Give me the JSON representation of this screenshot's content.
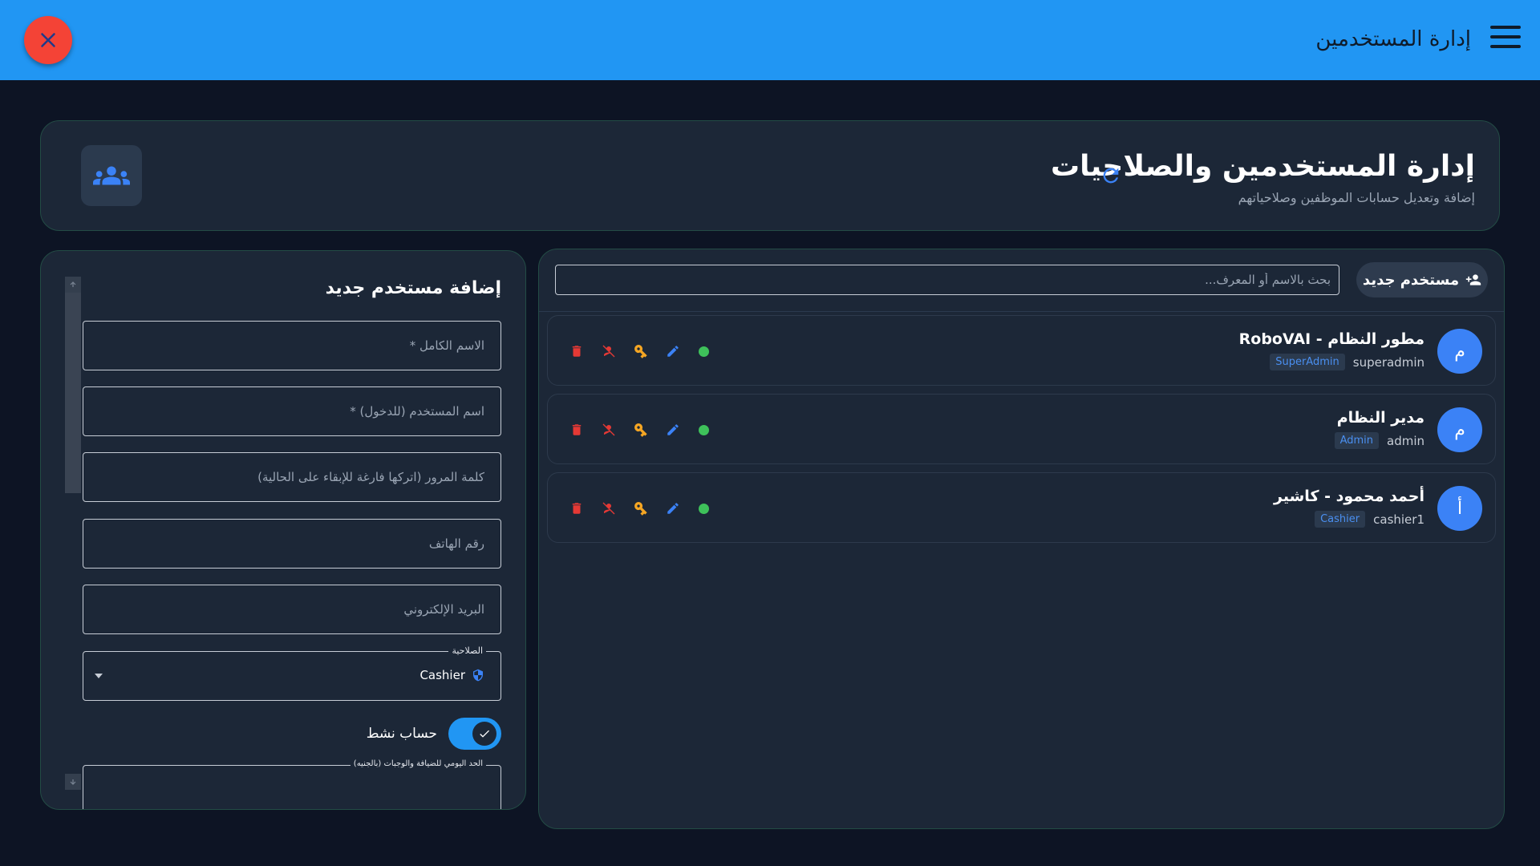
{
  "appbar": {
    "title": "إدارة المستخدمين",
    "menu_icon": "hamburger-menu-icon",
    "close_icon": "close-icon",
    "close_color": "#f44336",
    "bar_color": "#2196f3"
  },
  "header": {
    "title": "إدارة المستخدمين والصلاحيات",
    "subtitle": "إضافة وتعديل حسابات الموظفين وصلاحياتهم",
    "refresh_icon": "refresh-icon",
    "group_icon": "users-group-icon"
  },
  "toolbar": {
    "new_user_label": "مستخدم جديد",
    "new_user_icon": "person-add-icon",
    "search_placeholder": "بحث بالاسم أو المعرف..."
  },
  "users": [
    {
      "initial": "م",
      "name": "مطور النظام - RoboVAI",
      "username": "superadmin",
      "role": "SuperAdmin",
      "active": true
    },
    {
      "initial": "م",
      "name": "مدير النظام",
      "username": "admin",
      "role": "Admin",
      "active": true
    },
    {
      "initial": "أ",
      "name": "أحمد محمود - كاشير",
      "username": "cashier1",
      "role": "Cashier",
      "active": true
    }
  ],
  "row_actions": [
    "delete-icon",
    "deactivate-user-icon",
    "key-icon",
    "edit-icon",
    "status-dot"
  ],
  "form": {
    "title": "إضافة مستخدم جديد",
    "full_name_placeholder": "الاسم الكامل *",
    "username_placeholder": "اسم المستخدم (للدخول) *",
    "password_placeholder": "كلمة المرور (اتركها فارغة للإبقاء على الحالية)",
    "phone_placeholder": "رقم الهاتف",
    "email_placeholder": "البريد الإلكتروني",
    "role_label": "الصلاحية",
    "role_value": "Cashier",
    "active_label": "حساب نشط",
    "active": true,
    "daily_limit_label": "الحد اليومي للضيافة والوجبات (بالجنيه)"
  },
  "colors": {
    "background": "#0d1424",
    "card": "#1c2737",
    "card_border": "#234c45",
    "accent": "#3b82f6",
    "delete": "#e53935",
    "key": "#f5a623",
    "active_dot": "#3ec15a"
  }
}
